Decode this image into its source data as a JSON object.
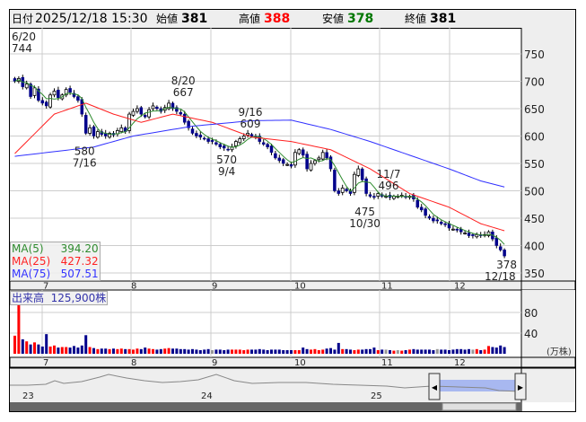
{
  "header": {
    "date_label": "日付",
    "date": "2025/12/18 15:30",
    "open_label": "始値",
    "open": "381",
    "high_label": "高値",
    "high": "388",
    "low_label": "安値",
    "low": "378",
    "close_label": "終値",
    "close": "381"
  },
  "colors": {
    "up_volume": "#ff0000",
    "down": "#00008b",
    "flat": "#999999",
    "ma5": "#2e8b2e",
    "ma25": "#ff2020",
    "ma75": "#3030ff",
    "high_text": "#ff0000",
    "low_text": "#007000"
  },
  "legend": {
    "ma5_label": "MA(5)",
    "ma5": "394.20",
    "ma25_label": "MA(25)",
    "ma25": "427.32",
    "ma75_label": "MA(75)",
    "ma75": "507.51"
  },
  "volume_legend": {
    "label": "出来高",
    "value": "125,900株"
  },
  "price_axis": [
    750,
    700,
    650,
    600,
    550,
    500,
    450,
    400,
    350
  ],
  "volume_axis": [
    80,
    40
  ],
  "volume_unit": "(万株)",
  "months": [
    "7",
    "8",
    "9",
    "10",
    "11",
    "12"
  ],
  "navigator_years": [
    "23",
    "24",
    "25"
  ],
  "annotations": [
    {
      "date": "6/20",
      "price": "744"
    },
    {
      "date": "7/16",
      "price": "580"
    },
    {
      "date": "8/20",
      "price": "667"
    },
    {
      "date": "9/4",
      "price": "570"
    },
    {
      "date": "9/16",
      "price": "609"
    },
    {
      "date": "10/30",
      "price": "475"
    },
    {
      "date": "11/7",
      "price": "496"
    },
    {
      "date": "12/18",
      "price": "378"
    }
  ],
  "chart_data": {
    "type": "candlestick",
    "closes": [
      700,
      705,
      690,
      695,
      672,
      688,
      665,
      660,
      655,
      675,
      682,
      670,
      675,
      685,
      680,
      672,
      665,
      640,
      605,
      615,
      600,
      608,
      603,
      600,
      605,
      602,
      610,
      615,
      608,
      640,
      645,
      650,
      640,
      635,
      648,
      655,
      650,
      645,
      652,
      660,
      650,
      645,
      640,
      625,
      615,
      605,
      600,
      598,
      595,
      590,
      590,
      585,
      580,
      578,
      575,
      580,
      590,
      595,
      600,
      605,
      600,
      598,
      590,
      585,
      580,
      570,
      560,
      555,
      550,
      548,
      545,
      570,
      575,
      565,
      540,
      550,
      555,
      560,
      570,
      560,
      540,
      500,
      495,
      505,
      500,
      495,
      530,
      540,
      520,
      495,
      490,
      488,
      495,
      490,
      490,
      488,
      490,
      490,
      492,
      488,
      490,
      485,
      470,
      465,
      455,
      450,
      445,
      445,
      440,
      438,
      432,
      430,
      428,
      425,
      423,
      418,
      418,
      420,
      418,
      420,
      425,
      412,
      400,
      392,
      381
    ],
    "volumes": [
      35,
      95,
      28,
      24,
      18,
      22,
      18,
      14,
      38,
      14,
      16,
      12,
      13,
      13,
      12,
      15,
      12,
      16,
      36,
      13,
      11,
      9,
      10,
      10,
      9,
      10,
      9,
      10,
      9,
      9,
      8,
      10,
      9,
      12,
      10,
      9,
      8,
      9,
      10,
      11,
      10,
      10,
      9,
      9,
      8,
      9,
      8,
      7,
      8,
      9,
      7,
      8,
      8,
      7,
      8,
      8,
      8,
      8,
      7,
      8,
      8,
      8,
      9,
      8,
      7,
      8,
      8,
      8,
      7,
      7,
      7,
      7,
      7,
      12,
      9,
      8,
      9,
      7,
      8,
      10,
      11,
      8,
      21,
      9,
      9,
      8,
      7,
      8,
      8,
      9,
      9,
      12,
      7,
      8,
      8,
      7,
      6,
      7,
      6,
      7,
      8,
      9,
      8,
      8,
      8,
      8,
      7,
      9,
      8,
      8,
      7,
      8,
      9,
      9,
      8,
      9,
      8,
      9,
      7,
      8,
      15,
      13,
      12,
      16,
      13
    ],
    "ma25_points": [
      [
        0,
        568
      ],
      [
        10,
        640
      ],
      [
        18,
        660
      ],
      [
        25,
        640
      ],
      [
        32,
        625
      ],
      [
        40,
        640
      ],
      [
        50,
        625
      ],
      [
        60,
        598
      ],
      [
        70,
        590
      ],
      [
        80,
        575
      ],
      [
        90,
        540
      ],
      [
        100,
        495
      ],
      [
        110,
        470
      ],
      [
        118,
        440
      ],
      [
        124,
        427
      ]
    ],
    "ma75_points": [
      [
        0,
        563
      ],
      [
        20,
        580
      ],
      [
        30,
        600
      ],
      [
        45,
        618
      ],
      [
        60,
        628
      ],
      [
        70,
        629
      ],
      [
        80,
        612
      ],
      [
        90,
        590
      ],
      [
        100,
        565
      ],
      [
        110,
        540
      ],
      [
        118,
        518
      ],
      [
        124,
        507
      ]
    ],
    "ylim": [
      340,
      790
    ],
    "volume_ylim": [
      0,
      120
    ]
  }
}
